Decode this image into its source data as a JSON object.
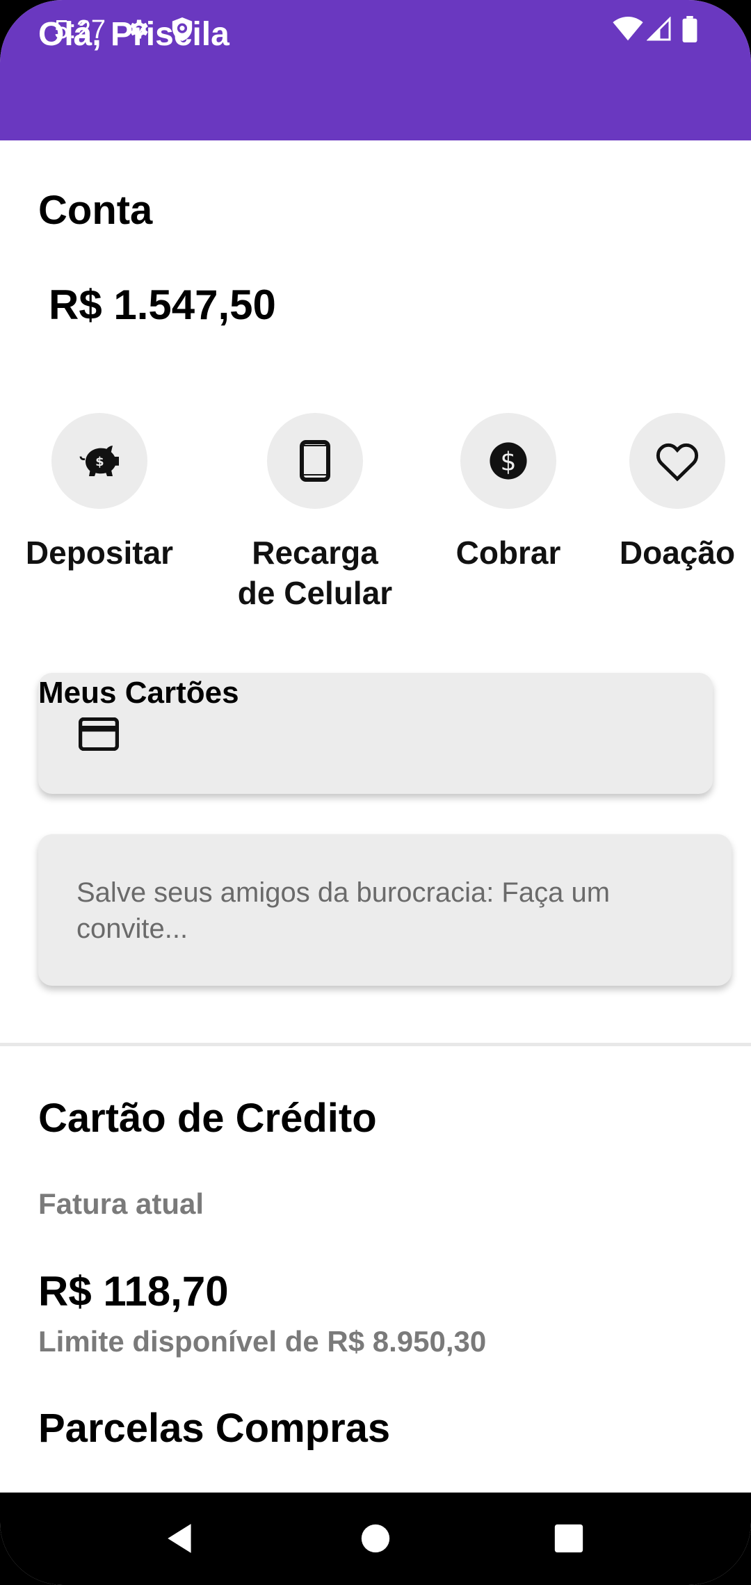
{
  "status_bar": {
    "time": "5:27",
    "icons": [
      "gear-icon",
      "shield-icon",
      "wifi-icon",
      "signal-icon",
      "battery-icon"
    ]
  },
  "header": {
    "greeting": "Olá, Priscila",
    "color": "#6a38c0"
  },
  "account": {
    "title": "Conta",
    "balance": "R$ 1.547,50"
  },
  "actions": [
    {
      "label": "Depositar",
      "icon": "piggy-bank-icon"
    },
    {
      "label": "Recarga de Celular",
      "icon": "smartphone-icon"
    },
    {
      "label": "Cobrar",
      "icon": "dollar-icon"
    },
    {
      "label": "Doação",
      "icon": "heart-icon"
    }
  ],
  "cards": {
    "title": "Meus Cartões",
    "icon": "credit-card-icon"
  },
  "invite": {
    "text": "Salve seus amigos da burocracia: Faça um convite..."
  },
  "credit_card": {
    "title": "Cartão de Crédito",
    "invoice_label": "Fatura atual",
    "invoice_amount": "R$ 118,70",
    "available_limit": "Limite disponível de R$ 8.950,30"
  },
  "installments": {
    "title": "Parcelas Compras"
  },
  "nav_bar": {
    "buttons": [
      "back-icon",
      "home-icon",
      "recents-icon"
    ]
  }
}
